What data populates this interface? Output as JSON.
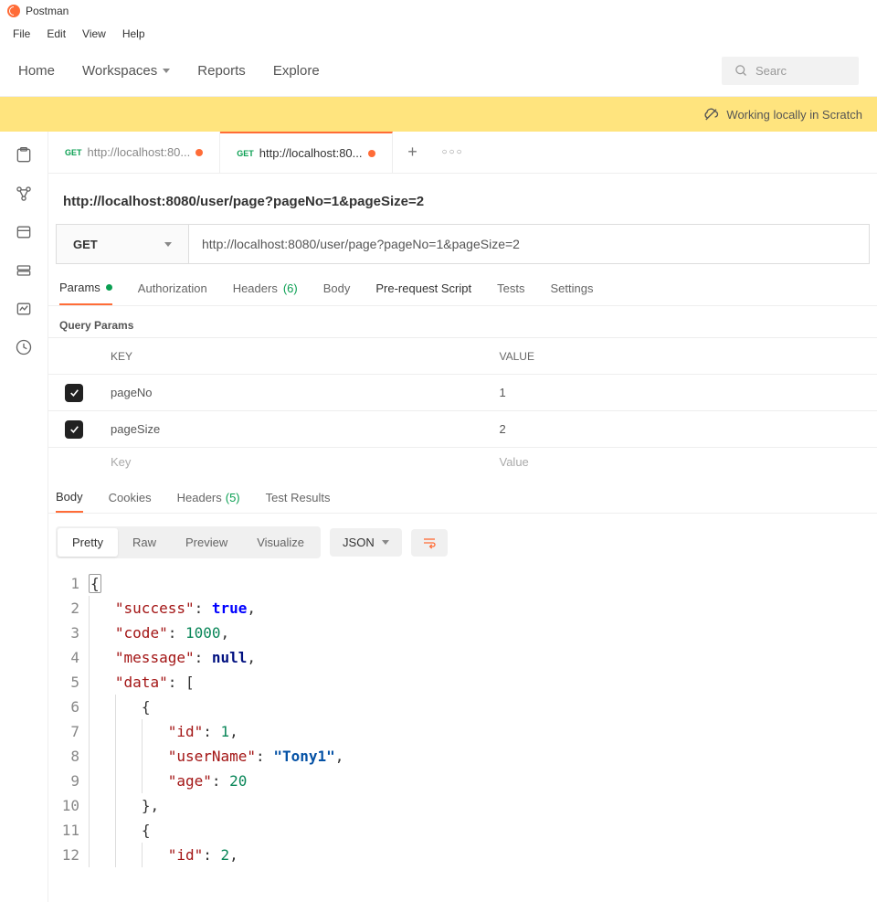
{
  "app": {
    "title": "Postman"
  },
  "menubar": [
    "File",
    "Edit",
    "View",
    "Help"
  ],
  "topnav": {
    "items": [
      "Home",
      "Workspaces",
      "Reports",
      "Explore"
    ],
    "search_placeholder": "Searc"
  },
  "banner": {
    "text": "Working locally in Scratch"
  },
  "tabs": [
    {
      "method": "GET",
      "label": "http://localhost:80...",
      "dirty": true,
      "active": false
    },
    {
      "method": "GET",
      "label": "http://localhost:80...",
      "dirty": true,
      "active": true
    }
  ],
  "request": {
    "title": "http://localhost:8080/user/page?pageNo=1&pageSize=2",
    "method": "GET",
    "url": "http://localhost:8080/user/page?pageNo=1&pageSize=2"
  },
  "req_tabs": [
    {
      "label": "Params",
      "active": true,
      "dot": true
    },
    {
      "label": "Authorization"
    },
    {
      "label": "Headers",
      "count": "(6)"
    },
    {
      "label": "Body"
    },
    {
      "label": "Pre-request Script"
    },
    {
      "label": "Tests"
    },
    {
      "label": "Settings"
    }
  ],
  "query_params": {
    "title": "Query Params",
    "header": {
      "key": "KEY",
      "value": "VALUE"
    },
    "rows": [
      {
        "checked": true,
        "key": "pageNo",
        "value": "1"
      },
      {
        "checked": true,
        "key": "pageSize",
        "value": "2"
      }
    ],
    "placeholder": {
      "key": "Key",
      "value": "Value"
    }
  },
  "resp_tabs": [
    {
      "label": "Body",
      "active": true
    },
    {
      "label": "Cookies"
    },
    {
      "label": "Headers",
      "count": "(5)"
    },
    {
      "label": "Test Results"
    }
  ],
  "resp_toolbar": {
    "views": [
      "Pretty",
      "Raw",
      "Preview",
      "Visualize"
    ],
    "format": "JSON"
  },
  "response_json": {
    "success": true,
    "code": 1000,
    "message": null,
    "data": [
      {
        "id": 1,
        "userName": "Tony1",
        "age": 20
      },
      {
        "id": 2
      }
    ]
  },
  "code_lines": 12
}
